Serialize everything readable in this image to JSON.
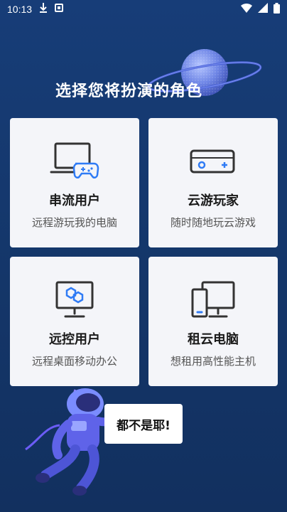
{
  "status_bar": {
    "time": "10:13"
  },
  "page": {
    "title": "选择您将扮演的角色"
  },
  "roles": [
    {
      "label": "串流用户",
      "description": "远程游玩我的电脑"
    },
    {
      "label": "云游玩家",
      "description": "随时随地玩云游戏"
    },
    {
      "label": "远控用户",
      "description": "远程桌面移动办公"
    },
    {
      "label": "租云电脑",
      "description": "想租用高性能主机"
    }
  ],
  "none_option": {
    "label": "都不是耶!"
  },
  "colors": {
    "background": "#163a72",
    "card": "#f4f5f9",
    "icon_dark": "#333333",
    "accent_blue": "#2f7bf5"
  }
}
